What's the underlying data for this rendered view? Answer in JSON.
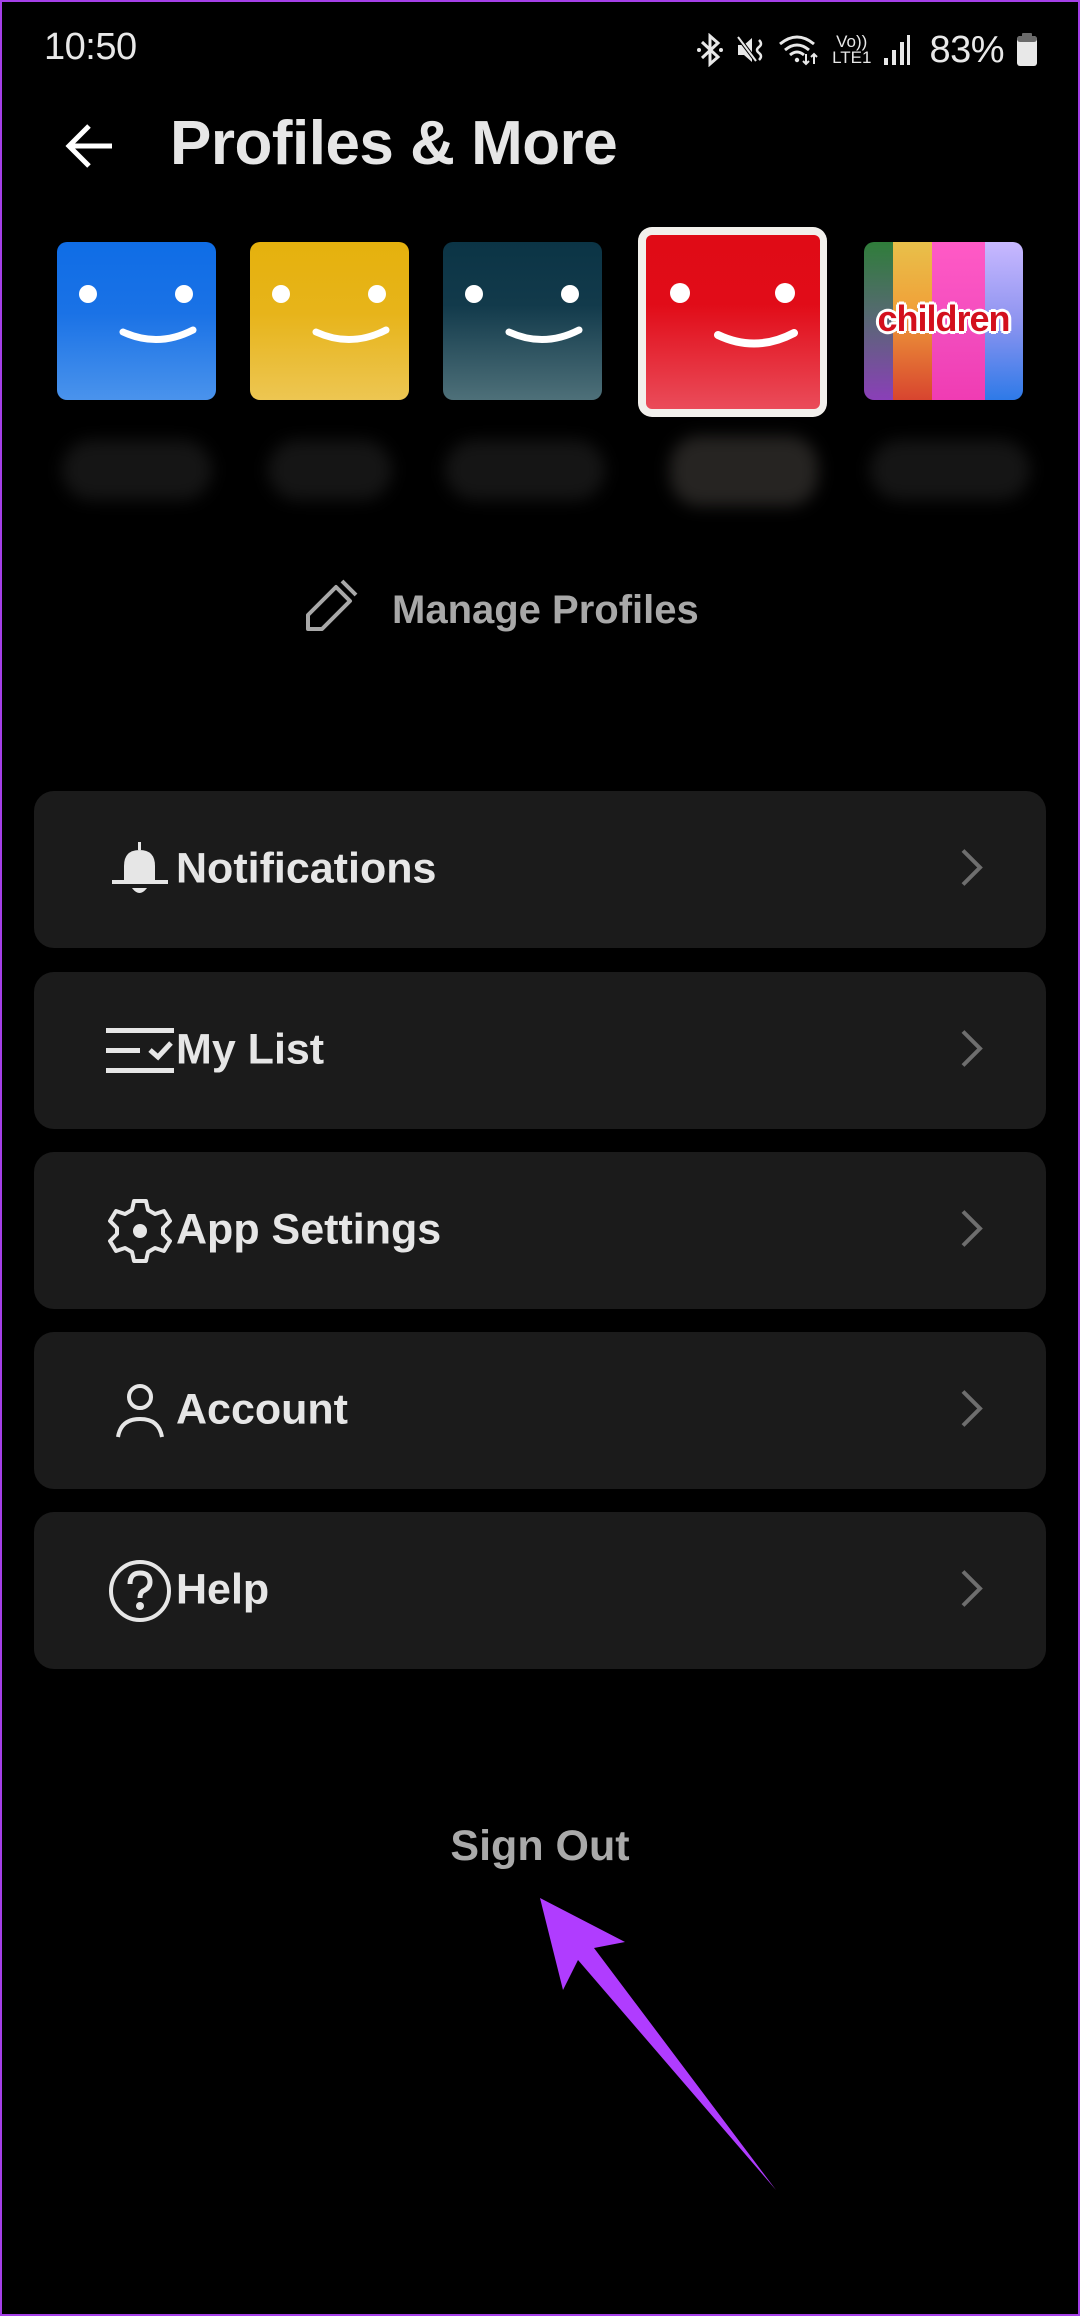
{
  "status_bar": {
    "time": "10:50",
    "icons": [
      "bluetooth-icon",
      "mute-icon",
      "wifi-icon",
      "volte-lte1-icon",
      "signal-icon",
      "battery-icon"
    ],
    "volte_label_top": "Vo))",
    "volte_label_bottom": "LTE1",
    "battery_percent": "83%"
  },
  "header": {
    "back_icon": "arrow-left-icon",
    "title": "Profiles & More"
  },
  "profiles": {
    "items": [
      {
        "type": "smiley",
        "color": "#1a72e6",
        "name_redacted": true,
        "selected": false
      },
      {
        "type": "smiley",
        "color": "#e7b41a",
        "name_redacted": true,
        "selected": false
      },
      {
        "type": "smiley",
        "color": "#123a4b",
        "name_redacted": true,
        "selected": false
      },
      {
        "type": "smiley",
        "color": "#e10c18",
        "name_redacted": true,
        "selected": true
      },
      {
        "type": "kids",
        "label": "children",
        "name_redacted": true,
        "selected": false
      }
    ],
    "manage_icon": "pencil-icon",
    "manage_label": "Manage Profiles"
  },
  "menu": {
    "items": [
      {
        "icon": "bell-icon",
        "label": "Notifications"
      },
      {
        "icon": "my-list-icon",
        "label": "My List"
      },
      {
        "icon": "gear-icon",
        "label": "App Settings"
      },
      {
        "icon": "person-icon",
        "label": "Account"
      },
      {
        "icon": "help-circle-icon",
        "label": "Help"
      }
    ],
    "chevron_icon": "chevron-right-icon"
  },
  "footer": {
    "sign_out_label": "Sign Out"
  },
  "annotation": {
    "type": "arrow",
    "color": "#b03cff",
    "points_to": "Sign Out"
  },
  "colors": {
    "background": "#000000",
    "card": "#1b1b1b",
    "text_primary": "#e6e6e6",
    "text_secondary": "#a8a8a8",
    "chevron": "#6e6e6e",
    "annotation": "#b03cff"
  }
}
